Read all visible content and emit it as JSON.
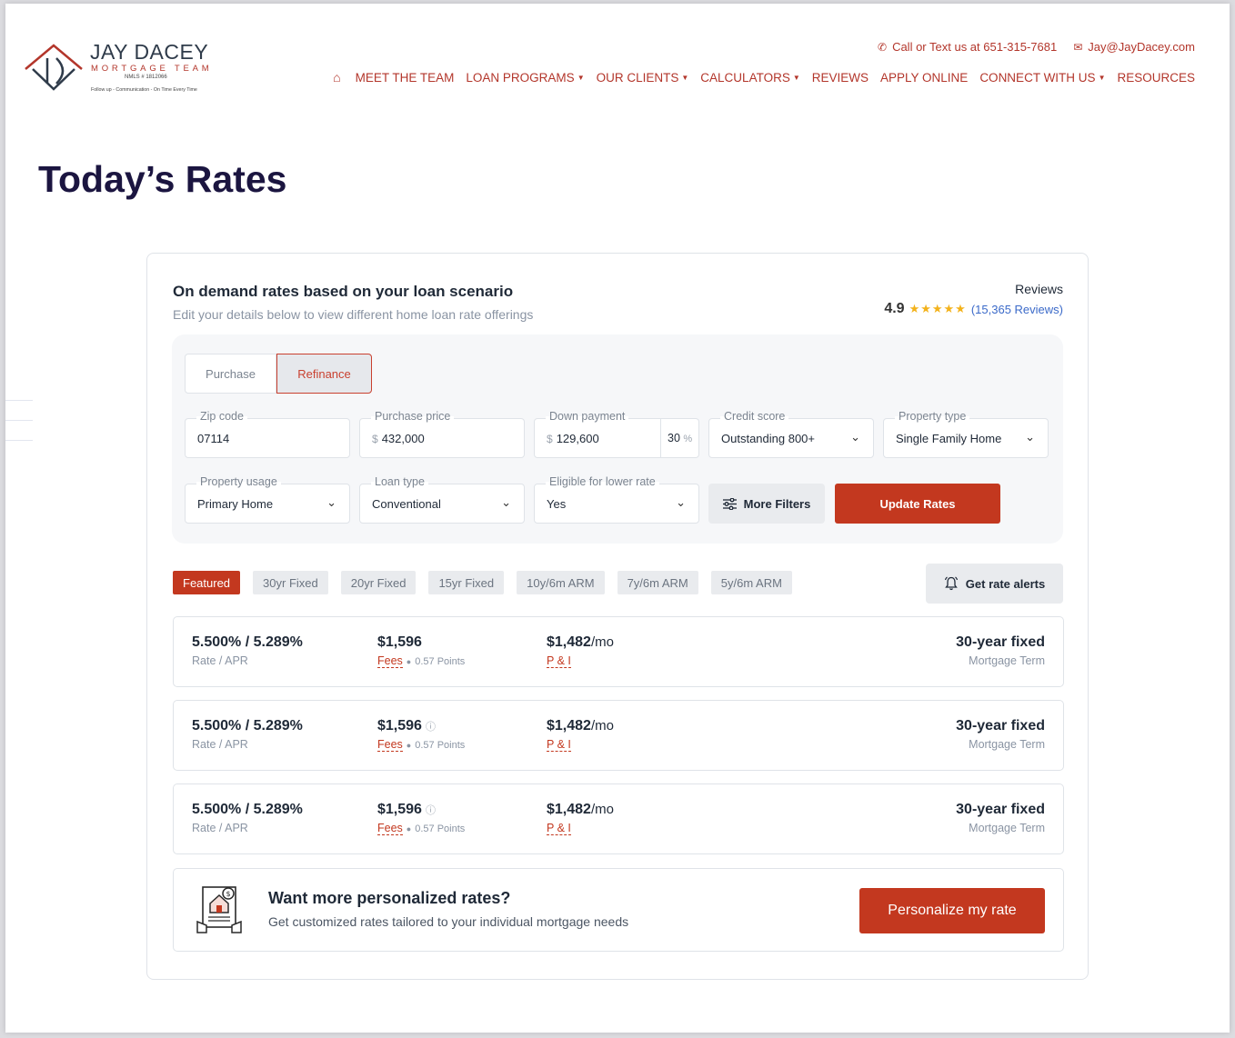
{
  "brand": {
    "name": "JAY DACEY",
    "sub": "MORTGAGE TEAM",
    "nmls": "NMLS # 1812066",
    "tagline": "Follow up - Communication - On Time Every Time"
  },
  "contact": {
    "phone_text": "Call or Text us at 651-315-7681",
    "email_text": "Jay@JayDacey.com"
  },
  "nav": {
    "items": [
      {
        "label": "MEET THE TEAM"
      },
      {
        "label": "LOAN PROGRAMS"
      },
      {
        "label": "OUR CLIENTS"
      },
      {
        "label": "CALCULATORS"
      },
      {
        "label": "REVIEWS"
      },
      {
        "label": "APPLY ONLINE"
      },
      {
        "label": "CONNECT WITH US"
      },
      {
        "label": "RESOURCES"
      }
    ]
  },
  "page_title": "Today’s Rates",
  "card": {
    "heading": "On demand rates based on your loan scenario",
    "subheading": "Edit your details below to view different home loan rate offerings",
    "reviews_label": "Reviews",
    "rating": "4.9",
    "stars": "★★★★★",
    "reviews_count": "(15,365 Reviews)"
  },
  "form": {
    "toggle": {
      "purchase": "Purchase",
      "refinance": "Refinance",
      "selected": "Refinance"
    },
    "zip": {
      "label": "Zip code",
      "value": "07114"
    },
    "price": {
      "label": "Purchase price",
      "prefix": "$",
      "value": "432,000"
    },
    "down": {
      "label": "Down payment",
      "prefix": "$",
      "value": "129,600",
      "percent": "30",
      "percent_sign": "%"
    },
    "credit": {
      "label": "Credit score",
      "value": "Outstanding 800+"
    },
    "property_type": {
      "label": "Property type",
      "value": "Single Family Home"
    },
    "usage": {
      "label": "Property usage",
      "value": "Primary Home"
    },
    "loan_type": {
      "label": "Loan type",
      "value": "Conventional"
    },
    "eligible": {
      "label": "Eligible for lower rate",
      "value": "Yes"
    },
    "more_filters": "More Filters",
    "update": "Update Rates"
  },
  "tabs": {
    "items": [
      {
        "label": "Featured"
      },
      {
        "label": "30yr Fixed"
      },
      {
        "label": "20yr Fixed"
      },
      {
        "label": "15yr Fixed"
      },
      {
        "label": "10y/6m ARM"
      },
      {
        "label": "7y/6m ARM"
      },
      {
        "label": "5y/6m ARM"
      }
    ],
    "active": "Featured",
    "alerts": "Get rate alerts"
  },
  "rates": [
    {
      "rate": "5.500% / 5.289%",
      "rate_label": "Rate / APR",
      "fees": "$1,596",
      "fees_label": "Fees",
      "points": "0.57 Points",
      "payment": "$1,482",
      "payment_unit": "/mo",
      "payment_label": "P & I",
      "term": "30-year fixed",
      "term_label": "Mortgage Term"
    },
    {
      "rate": "5.500% / 5.289%",
      "rate_label": "Rate / APR",
      "fees": "$1,596",
      "fees_label": "Fees",
      "points": "0.57 Points",
      "payment": "$1,482",
      "payment_unit": "/mo",
      "payment_label": "P & I",
      "term": "30-year fixed",
      "term_label": "Mortgage Term"
    },
    {
      "rate": "5.500% / 5.289%",
      "rate_label": "Rate / APR",
      "fees": "$1,596",
      "fees_label": "Fees",
      "points": "0.57 Points",
      "payment": "$1,482",
      "payment_unit": "/mo",
      "payment_label": "P & I",
      "term": "30-year fixed",
      "term_label": "Mortgage Term"
    }
  ],
  "promo": {
    "heading": "Want more personalized rates?",
    "sub": "Get customized rates tailored to your individual mortgage needs",
    "button": "Personalize my rate"
  },
  "colors": {
    "accent": "#c3381f",
    "title": "#1b1540",
    "link": "#3b6ac9",
    "star": "#f3b21b"
  }
}
